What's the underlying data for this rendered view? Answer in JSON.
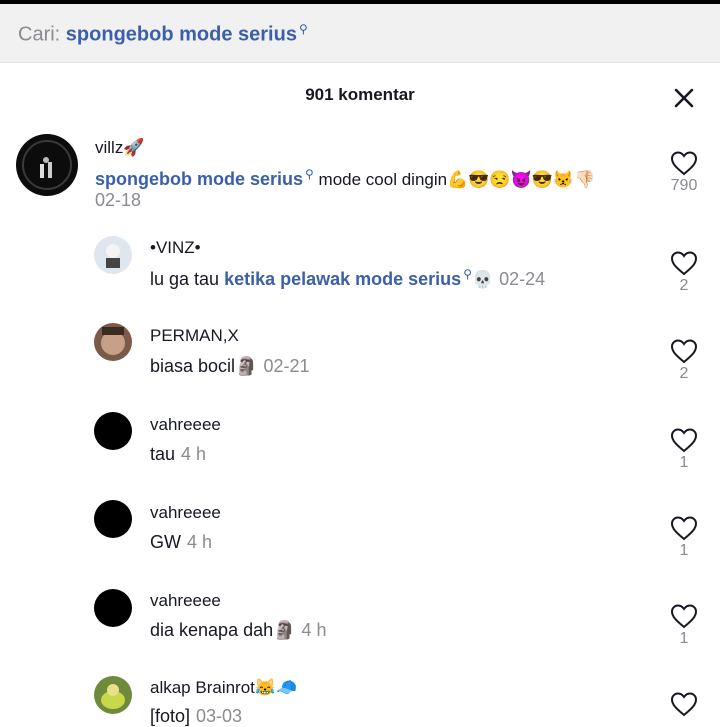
{
  "search": {
    "prefix": "Cari:",
    "query": "spongebob mode serius"
  },
  "header": {
    "count_label": "901 komentar"
  },
  "comments": [
    {
      "user": "villz🚀",
      "link": "spongebob mode serius",
      "text": " mode cool dingin💪😎😒😈😎😾👎🏻",
      "date": "02-18",
      "likes": "790"
    },
    {
      "user": "•VINZ•",
      "pre": "lu ga tau ",
      "link": "ketika pelawak mode serius",
      "post": "💀",
      "date": "02-24",
      "likes": "2"
    },
    {
      "user": "PERMAN,X",
      "text": "biasa bocil🗿",
      "date": "02-21",
      "likes": "2"
    },
    {
      "user": "vahreeee",
      "text": "tau",
      "date": "4 h",
      "likes": "1"
    },
    {
      "user": "vahreeee",
      "text": "GW",
      "date": "4 h",
      "likes": "1"
    },
    {
      "user": "vahreeee",
      "text": "dia kenapa dah🗿",
      "date": "4 h",
      "likes": "1"
    },
    {
      "user": "alkap Brainrot😹🧢",
      "text": "[foto]",
      "date": "03-03",
      "likes": ""
    }
  ]
}
